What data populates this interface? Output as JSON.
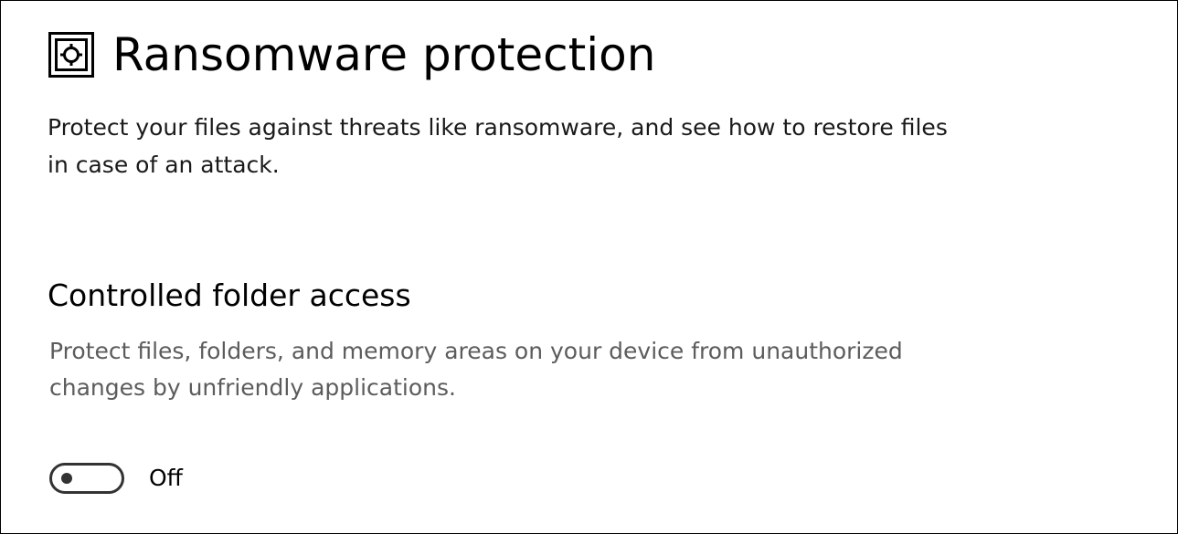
{
  "header": {
    "icon": "ransomware-protection-icon",
    "title": "Ransomware protection"
  },
  "description": "Protect your files against threats like ransomware, and see how to restore files in case of an attack.",
  "controlled_folder_access": {
    "title": "Controlled folder access",
    "description": "Protect files, folders, and memory areas on your device from unauthorized changes by unfriendly applications.",
    "toggle": {
      "state": "off",
      "label": "Off"
    }
  },
  "colors": {
    "text": "#000000",
    "secondary_text": "#5c5c5c",
    "toggle_border": "#333333",
    "background": "#ffffff"
  }
}
